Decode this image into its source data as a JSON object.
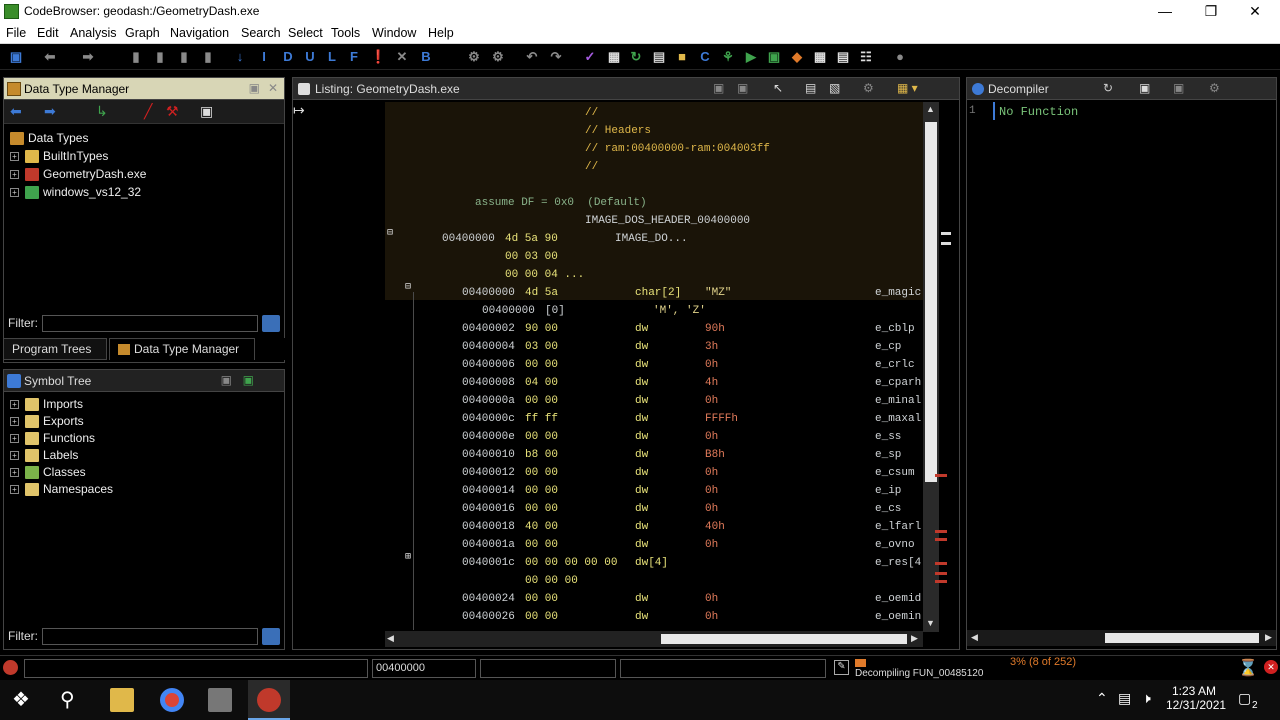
{
  "window": {
    "title": "CodeBrowser: geodash:/GeometryDash.exe"
  },
  "menu": [
    "File",
    "Edit",
    "Analysis",
    "Graph",
    "Navigation",
    "Search",
    "Select",
    "Tools",
    "Window",
    "Help"
  ],
  "data_type_manager": {
    "title": "Data Type Manager",
    "root": "Data Types",
    "items": [
      "BuiltInTypes",
      "GeometryDash.exe",
      "windows_vs12_32"
    ],
    "filter_label": "Filter:",
    "filter_value": ""
  },
  "tabs": {
    "program_trees": "Program Trees",
    "data_type_manager": "Data Type Manager"
  },
  "symbol_tree": {
    "title": "Symbol Tree",
    "items": [
      "Imports",
      "Exports",
      "Functions",
      "Labels",
      "Classes",
      "Namespaces"
    ],
    "filter_label": "Filter:",
    "filter_value": ""
  },
  "listing": {
    "title": "Listing:  GeometryDash.exe",
    "header_comments": [
      "//",
      "// Headers",
      "// ram:00400000-ram:004003ff",
      "//"
    ],
    "assume": "assume DF = 0x0  (Default)",
    "label": "IMAGE_DOS_HEADER_00400000",
    "struct_row": {
      "addr": "00400000",
      "bytes": "4d 5a 90",
      "name": "IMAGE_DO..."
    },
    "struct_cont": [
      "00 03 00",
      "00 00 04 ..."
    ],
    "magic_row": {
      "addr": "00400000",
      "bytes": "4d 5a",
      "type": "char[2]",
      "value": "\"MZ\"",
      "field": "e_magic"
    },
    "magic_sub": {
      "addr": "00400000",
      "idx": "[0]",
      "value": "'M', 'Z'"
    },
    "rows": [
      {
        "addr": "00400002",
        "bytes": "90 00",
        "mnem": "dw",
        "val": "90h",
        "field": "e_cblp"
      },
      {
        "addr": "00400004",
        "bytes": "03 00",
        "mnem": "dw",
        "val": "3h",
        "field": "e_cp"
      },
      {
        "addr": "00400006",
        "bytes": "00 00",
        "mnem": "dw",
        "val": "0h",
        "field": "e_crlc"
      },
      {
        "addr": "00400008",
        "bytes": "04 00",
        "mnem": "dw",
        "val": "4h",
        "field": "e_cparh"
      },
      {
        "addr": "0040000a",
        "bytes": "00 00",
        "mnem": "dw",
        "val": "0h",
        "field": "e_minal"
      },
      {
        "addr": "0040000c",
        "bytes": "ff ff",
        "mnem": "dw",
        "val": "FFFFh",
        "field": "e_maxal"
      },
      {
        "addr": "0040000e",
        "bytes": "00 00",
        "mnem": "dw",
        "val": "0h",
        "field": "e_ss"
      },
      {
        "addr": "00400010",
        "bytes": "b8 00",
        "mnem": "dw",
        "val": "B8h",
        "field": "e_sp"
      },
      {
        "addr": "00400012",
        "bytes": "00 00",
        "mnem": "dw",
        "val": "0h",
        "field": "e_csum"
      },
      {
        "addr": "00400014",
        "bytes": "00 00",
        "mnem": "dw",
        "val": "0h",
        "field": "e_ip"
      },
      {
        "addr": "00400016",
        "bytes": "00 00",
        "mnem": "dw",
        "val": "0h",
        "field": "e_cs"
      },
      {
        "addr": "00400018",
        "bytes": "40 00",
        "mnem": "dw",
        "val": "40h",
        "field": "e_lfarl"
      },
      {
        "addr": "0040001a",
        "bytes": "00 00",
        "mnem": "dw",
        "val": "0h",
        "field": "e_ovno"
      }
    ],
    "res_row": {
      "addr": "0040001c",
      "bytes": "00 00 00 00 00",
      "mnem": "dw[4]",
      "field": "e_res[4"
    },
    "res_cont": "00 00 00",
    "rows2": [
      {
        "addr": "00400024",
        "bytes": "00 00",
        "mnem": "dw",
        "val": "0h",
        "field": "e_oemid"
      },
      {
        "addr": "00400026",
        "bytes": "00 00",
        "mnem": "dw",
        "val": "0h",
        "field": "e_oemin"
      }
    ]
  },
  "decompiler": {
    "title": "Decompiler",
    "line_no": "1",
    "text": "No Function"
  },
  "status": {
    "address": "00400000",
    "task": "Decompiling FUN_00485120",
    "progress_text": "3% (8 of 252)",
    "progress": 0.03
  },
  "taskbar": {
    "time": "1:23 AM",
    "date": "12/31/2021",
    "notif_count": "2"
  },
  "colors": {
    "listing_header_bg": "#1a1408",
    "comment": "#e0b84a",
    "bytes": "#e9e37a",
    "value": "#e07a5a"
  }
}
